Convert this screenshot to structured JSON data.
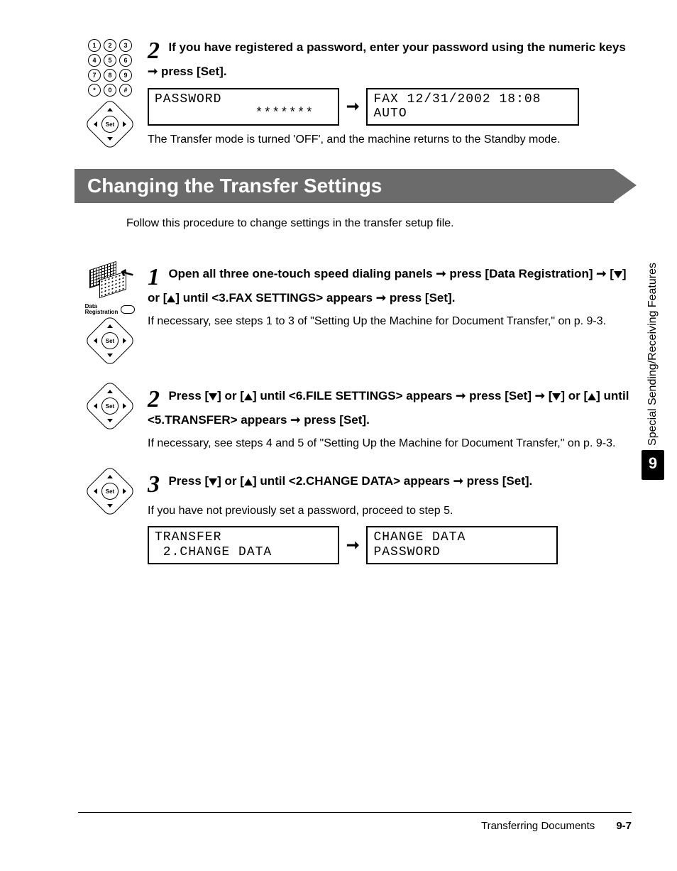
{
  "top_step": {
    "num": "2",
    "instruction_pre": "If you have registered a password, enter your password using the numeric keys ",
    "instruction_post": " press [Set].",
    "lcd1_l1": "PASSWORD",
    "lcd1_l2": "            *******",
    "lcd2_l1": "FAX 12/31/2002 18:08",
    "lcd2_l2": "AUTO",
    "note": "The Transfer mode is turned 'OFF', and the machine returns to the Standby mode."
  },
  "section_title": "Changing the Transfer Settings",
  "section_intro": "Follow this procedure to change settings in the transfer setup file.",
  "s1": {
    "num": "1",
    "p1": "Open all three one-touch speed dialing panels ",
    "p2": " press [Data Registration] ",
    "p3": " [",
    "p4": "] or [",
    "p5": "] until <3.FAX SETTINGS> appears ",
    "p6": " press [Set].",
    "note": "If necessary, see steps 1 to 3 of \"Setting Up the Machine for Document Transfer,\" on p. 9-3.",
    "data_reg_label": "Data\nRegistration",
    "set_label": "Set"
  },
  "s2": {
    "num": "2",
    "p1": "Press [",
    "p2": "] or [",
    "p3": "] until <6.FILE SETTINGS> appears ",
    "p4": " press [Set] ",
    "p5": " [",
    "p6": "] or [",
    "p7": "] until <5.TRANSFER> appears ",
    "p8": " press [Set].",
    "note": "If necessary, see steps 4 and 5 of \"Setting Up the Machine for Document Transfer,\" on p. 9-3."
  },
  "s3": {
    "num": "3",
    "p1": "Press [",
    "p2": "] or [",
    "p3": "] until <2.CHANGE DATA> appears ",
    "p4": " press [Set].",
    "note": "If you have not previously set a password, proceed to step 5.",
    "lcd1_l1": "TRANSFER",
    "lcd1_l2": " 2.CHANGE DATA",
    "lcd2_l1": "CHANGE DATA",
    "lcd2_l2": "PASSWORD"
  },
  "side": {
    "label": "Special Sending/Receiving Features",
    "chapter": "9"
  },
  "footer": {
    "title": "Transferring Documents",
    "page": "9-7"
  },
  "glyphs": {
    "rarrow": "➞"
  }
}
